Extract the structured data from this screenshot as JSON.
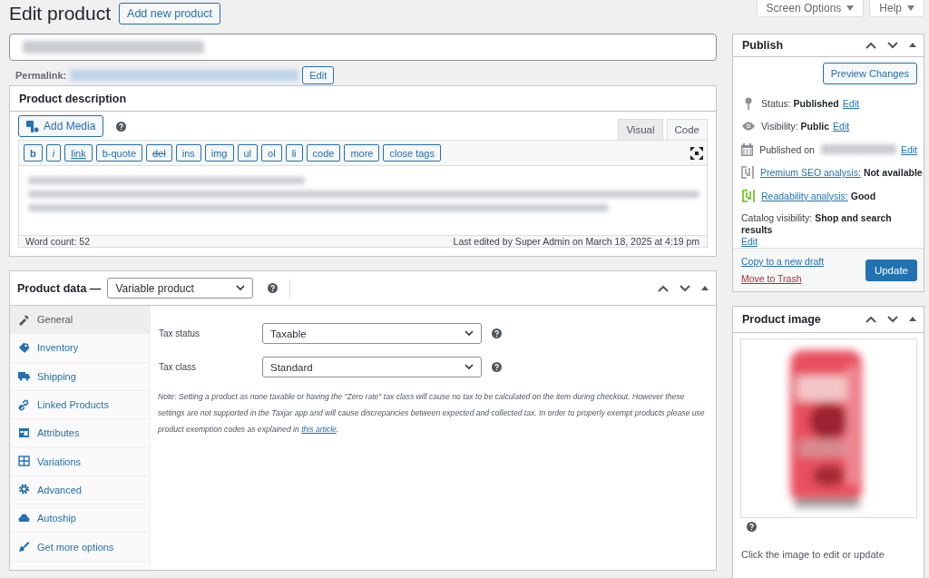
{
  "page": {
    "title": "Edit product",
    "add_new": "Add new product"
  },
  "screen_tabs": [
    "Screen Options",
    "Help"
  ],
  "permalink": {
    "label": "Permalink:",
    "edit": "Edit"
  },
  "description": {
    "title": "Product description",
    "add_media": "Add Media",
    "tabs": [
      {
        "label": "Visual",
        "selected": false
      },
      {
        "label": "Code",
        "selected": true
      }
    ],
    "quicktags": [
      {
        "label": "b",
        "kind": "bold"
      },
      {
        "label": "i",
        "kind": "italic"
      },
      {
        "label": "link",
        "kind": "underline"
      },
      {
        "label": "b-quote",
        "kind": "plain"
      },
      {
        "label": "del",
        "kind": "strike"
      },
      {
        "label": "ins",
        "kind": "plain"
      },
      {
        "label": "img",
        "kind": "plain"
      },
      {
        "label": "ul",
        "kind": "plain"
      },
      {
        "label": "ol",
        "kind": "plain"
      },
      {
        "label": "li",
        "kind": "plain"
      },
      {
        "label": "code",
        "kind": "plain"
      },
      {
        "label": "more",
        "kind": "plain"
      },
      {
        "label": "close tags",
        "kind": "plain"
      }
    ],
    "word_count": "Word count: 52",
    "last_edited": "Last edited by Super Admin on March 18, 2025 at 4:19 pm"
  },
  "product_data": {
    "title": "Product data —",
    "type": "Variable product",
    "tabs": [
      {
        "label": "General",
        "selected": true
      },
      {
        "label": "Inventory",
        "selected": false
      },
      {
        "label": "Shipping",
        "selected": false
      },
      {
        "label": "Linked Products",
        "selected": false
      },
      {
        "label": "Attributes",
        "selected": false
      },
      {
        "label": "Variations",
        "selected": false
      },
      {
        "label": "Advanced",
        "selected": false
      },
      {
        "label": "Autoship",
        "selected": false
      },
      {
        "label": "Get more options",
        "selected": false
      }
    ],
    "fields": [
      {
        "label": "Tax status",
        "value": "Taxable"
      },
      {
        "label": "Tax class",
        "value": "Standard"
      }
    ],
    "note": "Note: Setting a product as none taxable or having the \"Zero rate\" tax class will cause no tax to be calculated on the item during checkout. However these settings are not supported in the Taxjar app and will cause discrepancies between expected and collected tax. In order to properly exempt products please use product exemption codes as explained in",
    "note_link": "this article",
    "note_end": "."
  },
  "publish": {
    "title": "Publish",
    "preview": "Preview Changes",
    "rows": [
      {
        "kind": "setting",
        "label": "Status:",
        "value": "Published",
        "link": "Edit"
      },
      {
        "kind": "setting",
        "label": "Visibility:",
        "value": "Public",
        "link": "Edit"
      },
      {
        "kind": "date",
        "label": "Published on",
        "link": "Edit"
      },
      {
        "kind": "analysis",
        "link": "Premium SEO analysis:",
        "value": "Not available",
        "color": "#a7aaad"
      },
      {
        "kind": "analysis",
        "link": "Readability analysis:",
        "value": "Good",
        "color": "#7ad03a"
      }
    ],
    "catalog_label": "Catalog visibility:",
    "catalog_value": "Shop and search results",
    "catalog_edit": "Edit",
    "copy": "Copy to a new draft",
    "trash": "Move to Trash",
    "update": "Update"
  },
  "product_image": {
    "title": "Product image",
    "hint": "Click the image to edit or update"
  }
}
